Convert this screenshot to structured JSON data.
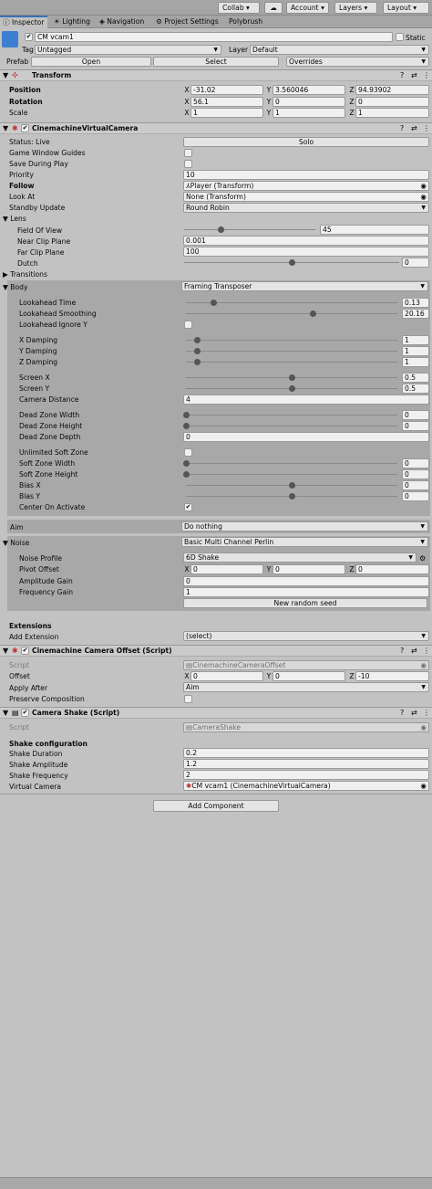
{
  "toolbar": {
    "collab": "Collab ▾",
    "cloud_icon": "cloud-icon",
    "account": "Account",
    "layers": "Layers",
    "layout": "Layout"
  },
  "tabs": [
    "Inspector",
    "Lighting",
    "Navigation",
    "Project Settings",
    "Polybrush"
  ],
  "object": {
    "name": "CM vcam1",
    "static": "Static",
    "tag_label": "Tag",
    "tag_value": "Untagged",
    "layer_label": "Layer",
    "layer_value": "Default",
    "prefab_label": "Prefab",
    "open": "Open",
    "select": "Select",
    "overrides": "Overrides"
  },
  "transform": {
    "title": "Transform",
    "position": "Position",
    "rotation": "Rotation",
    "scale": "Scale",
    "pos": [
      "-31.02",
      "3.560046",
      "94.93902"
    ],
    "rot": [
      "56.1",
      "0",
      "0"
    ],
    "scl": [
      "1",
      "1",
      "1"
    ]
  },
  "vcam": {
    "title": "CinemachineVirtualCamera",
    "status": "Status: Live",
    "solo": "Solo",
    "game_window_guides": "Game Window Guides",
    "save_during_play": "Save During Play",
    "priority": "Priority",
    "priority_value": "10",
    "follow": "Follow",
    "follow_value": "Player (Transform)",
    "look_at": "Look At",
    "look_at_value": "None (Transform)",
    "standby_update": "Standby Update",
    "standby_value": "Round Robin",
    "lens": "Lens",
    "fov": "Field Of View",
    "fov_value": "45",
    "fov_fraction": 0.28,
    "near_clip": "Near Clip Plane",
    "near_value": "0.001",
    "far_clip": "Far Clip Plane",
    "far_value": "100",
    "dutch": "Dutch",
    "dutch_value": "0",
    "dutch_fraction": 0.5,
    "transitions": "Transitions"
  },
  "body": {
    "label": "Body",
    "value": "Framing Transposer",
    "rows": [
      {
        "label": "Lookahead Time",
        "value": "0.13",
        "frac": 0.13
      },
      {
        "label": "Lookahead Smoothing",
        "value": "20.16",
        "frac": 0.6
      },
      {
        "label": "Lookahead Ignore Y",
        "check": false
      },
      {
        "label": "X Damping",
        "value": "1",
        "frac": 0.05
      },
      {
        "label": "Y Damping",
        "value": "1",
        "frac": 0.05
      },
      {
        "label": "Z Damping",
        "value": "1",
        "frac": 0.05
      },
      {
        "label": "Screen X",
        "value": "0.5",
        "frac": 0.5
      },
      {
        "label": "Screen Y",
        "value": "0.5",
        "frac": 0.5
      },
      {
        "label": "Camera Distance",
        "value": "4"
      },
      {
        "label": "Dead Zone Width",
        "value": "0",
        "frac": 0
      },
      {
        "label": "Dead Zone Height",
        "value": "0",
        "frac": 0
      },
      {
        "label": "Dead Zone Depth",
        "value": "0"
      },
      {
        "label": "Unlimited Soft Zone",
        "check": false
      },
      {
        "label": "Soft Zone Width",
        "value": "0",
        "frac": 0
      },
      {
        "label": "Soft Zone Height",
        "value": "0",
        "frac": 0
      },
      {
        "label": "Bias X",
        "value": "0",
        "frac": 0.5
      },
      {
        "label": "Bias Y",
        "value": "0",
        "frac": 0.5
      },
      {
        "label": "Center On Activate",
        "check": true
      }
    ]
  },
  "aim": {
    "label": "Aim",
    "value": "Do nothing"
  },
  "noise": {
    "label": "Noise",
    "value": "Basic Multi Channel Perlin",
    "profile": "Noise Profile",
    "profile_value": "6D Shake",
    "pivot": "Pivot Offset",
    "pivot_values": [
      "0",
      "0",
      "0"
    ],
    "amplitude": "Amplitude Gain",
    "amplitude_value": "0",
    "frequency": "Frequency Gain",
    "frequency_value": "1",
    "new_seed": "New random seed"
  },
  "extensions": {
    "title": "Extensions",
    "add": "Add Extension",
    "add_value": "(select)"
  },
  "offset": {
    "title": "Cinemachine Camera Offset (Script)",
    "script": "Script",
    "script_value": "CinemachineCameraOffset",
    "offset": "Offset",
    "offset_values": [
      "0",
      "0",
      "-10"
    ],
    "apply_after": "Apply After",
    "apply_value": "Aim",
    "preserve": "Preserve Composition"
  },
  "shake": {
    "title": "Camera Shake (Script)",
    "script": "Script",
    "script_value": "CameraShake",
    "config": "Shake configuration",
    "duration": "Shake Duration",
    "duration_value": "0.2",
    "amplitude": "Shake Amplitude",
    "amplitude_value": "1.2",
    "frequency": "Shake Frequency",
    "frequency_value": "2",
    "vcam": "Virtual Camera",
    "vcam_value": "CM vcam1 (CinemachineVirtualCamera)"
  },
  "add_component": "Add Component",
  "axes": {
    "x": "X",
    "y": "Y",
    "z": "Z"
  }
}
